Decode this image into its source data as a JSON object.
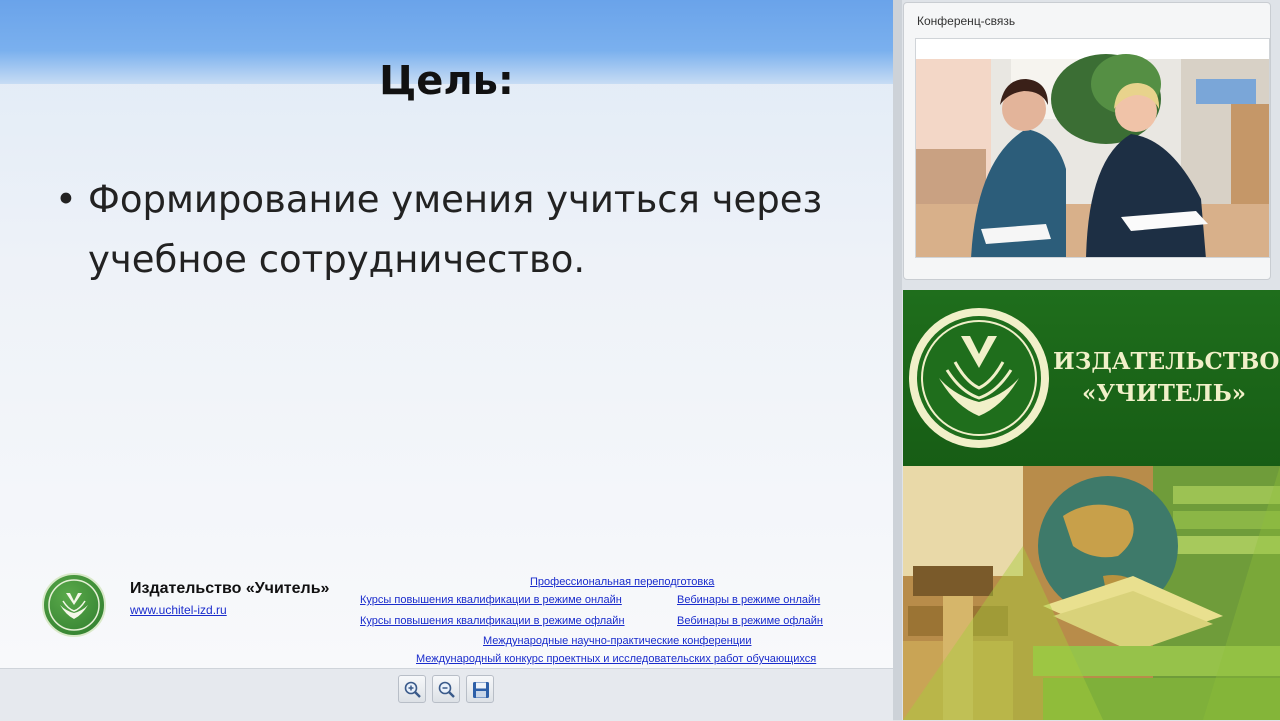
{
  "slide": {
    "title": "Цель:",
    "bullet_symbol": "•",
    "bullet_text": "Формирование умения учиться через учебное сотрудничество."
  },
  "footer": {
    "company": "Издательство «Учитель»",
    "url": "www.uchitel-izd.ru",
    "links": [
      "Профессиональная переподготовка",
      "Курсы повышения квалификации в режиме онлайн",
      "Вебинары в режиме онлайн",
      "Курсы повышения квалификации в режиме офлайн",
      "Вебинары в режиме офлайн",
      "Международные научно-практические конференции",
      "Международный конкурс проектных и исследовательских работ обучающихся"
    ]
  },
  "toolbar": {
    "icons": [
      "zoom-in-icon",
      "zoom-out-icon",
      "save-icon"
    ]
  },
  "video": {
    "title": "Конференц-связь"
  },
  "banner": {
    "line1": "ИЗДАТЕЛЬСТВО",
    "line2": "«УЧИТЕЛЬ»"
  },
  "colors": {
    "link": "#1a2ccc",
    "banner_green": "#1f6e1c",
    "banner_text": "#f1f0c9"
  }
}
